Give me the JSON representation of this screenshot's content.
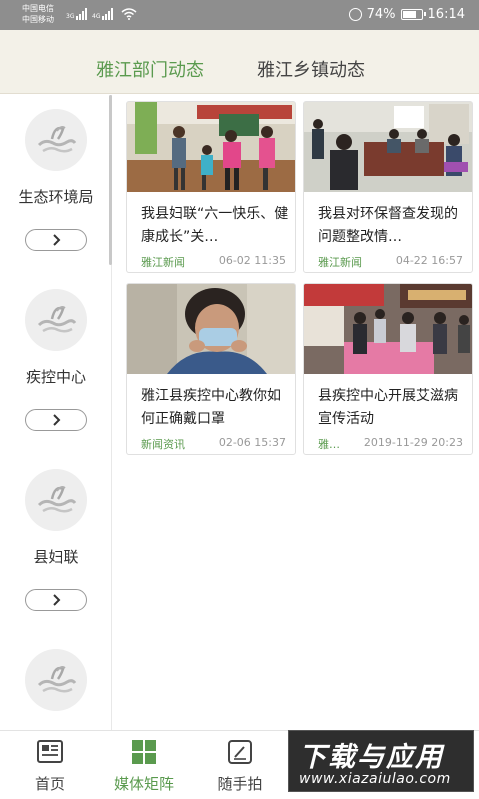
{
  "status_bar": {
    "carrier_1": "中国电信",
    "carrier_2": "中国移动",
    "signal_1_label": "3G",
    "signal_2_label": "4G",
    "battery": "74%",
    "time": "16:14"
  },
  "header": {
    "tabs": [
      {
        "label": "雅江部门动态",
        "active": true
      },
      {
        "label": "雅江乡镇动态",
        "active": false
      }
    ]
  },
  "sidebar": {
    "departments": [
      {
        "name": "生态环境局",
        "button_icon": "chevron-right-icon"
      },
      {
        "name": "疾控中心",
        "button_icon": "chevron-right-icon"
      },
      {
        "name": "县妇联",
        "button_icon": "chevron-right-icon"
      }
    ]
  },
  "news": [
    {
      "title": "我县妇联“六一快乐、健康成长”关…",
      "source": "雅江新闻",
      "date": "06-02 11:35"
    },
    {
      "title": "我县对环保督查发现的问题整改情…",
      "source": "雅江新闻",
      "date": "04-22 16:57"
    },
    {
      "title": "雅江县疾控中心教你如何正确戴口罩",
      "source": "新闻资讯",
      "date": "02-06 15:37"
    },
    {
      "title": "县疾控中心开展艾滋病宣传活动",
      "source": "雅…",
      "date": "2019-11-29 20:23"
    }
  ],
  "bottom_nav": [
    {
      "label": "首页",
      "icon": "newspaper-icon",
      "active": false
    },
    {
      "label": "媒体矩阵",
      "icon": "grid-icon",
      "active": true
    },
    {
      "label": "随手拍",
      "icon": "edit-icon",
      "active": false
    }
  ],
  "watermark": {
    "line1": "下载与应用",
    "line2": "www.xiazaiulao.com"
  },
  "colors": {
    "accent": "#5a9a4e",
    "header_bg": "#f3f1e8",
    "status_bg": "#8e8e8e"
  }
}
